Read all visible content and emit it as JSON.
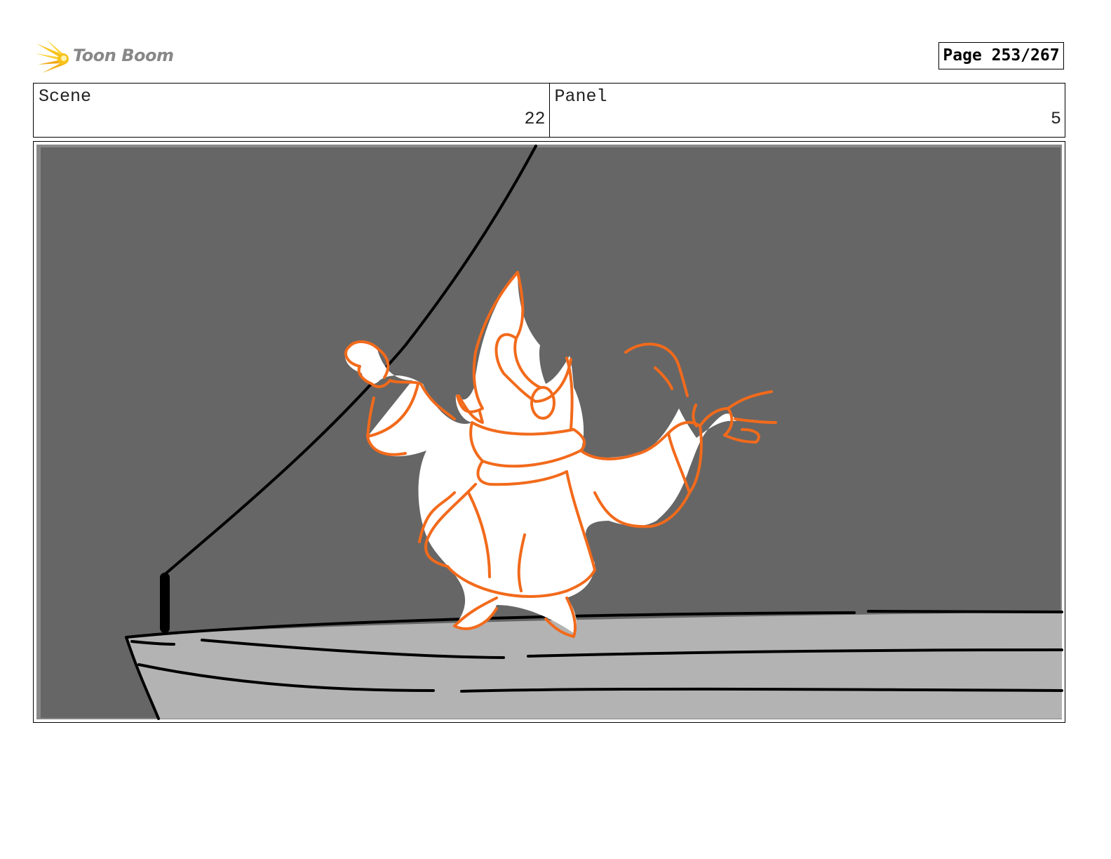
{
  "header": {
    "logo_text": "Toon Boom",
    "logo_icon": "sunburst-icon",
    "page_label": "Page 253/267"
  },
  "info": {
    "scene_label": "Scene",
    "scene_value": "22",
    "panel_label": "Panel",
    "panel_value": "5"
  },
  "colors": {
    "accent_orange": "#f26a1b",
    "logo_yellow": "#f7c21a",
    "background_gray": "#666666",
    "deck_gray": "#b3b3b3"
  }
}
